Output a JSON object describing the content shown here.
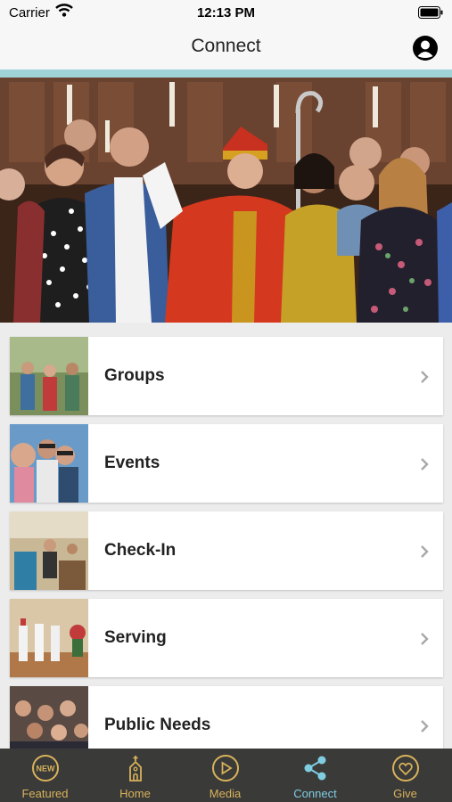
{
  "status_bar": {
    "carrier": "Carrier",
    "time": "12:13 PM"
  },
  "header": {
    "title": "Connect"
  },
  "connect_items": [
    {
      "label": "Groups"
    },
    {
      "label": "Events"
    },
    {
      "label": "Check-In"
    },
    {
      "label": "Serving"
    },
    {
      "label": "Public Needs"
    }
  ],
  "tab_bar": {
    "badge_text": "NEW",
    "tabs": [
      {
        "label": "Featured",
        "icon": "new-badge-icon"
      },
      {
        "label": "Home",
        "icon": "church-icon"
      },
      {
        "label": "Media",
        "icon": "play-icon"
      },
      {
        "label": "Connect",
        "icon": "share-icon",
        "active": true
      },
      {
        "label": "Give",
        "icon": "heart-icon"
      }
    ]
  },
  "colors": {
    "accent_line": "#9fd3d8",
    "tab_bar_bg": "#3a3a39",
    "tab_inactive": "#d8b25a",
    "tab_active": "#7fcde0"
  }
}
